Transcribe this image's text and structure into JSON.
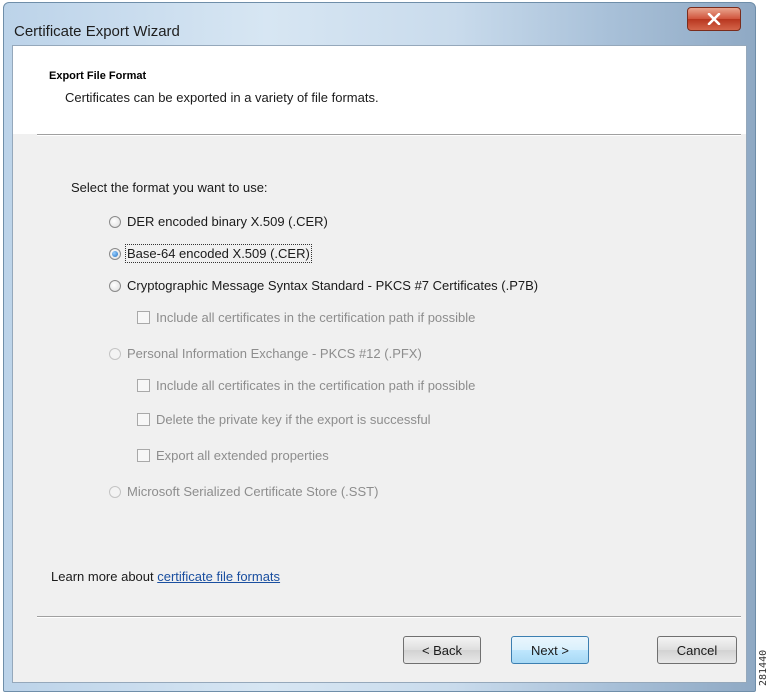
{
  "window": {
    "title": "Certificate Export Wizard",
    "close_icon": "close-x-icon"
  },
  "header": {
    "title": "Export File Format",
    "subtitle": "Certificates can be exported in a variety of file formats."
  },
  "prompt": "Select the format you want to use:",
  "options": [
    {
      "label": "DER encoded binary X.509 (.CER)",
      "selected": false,
      "enabled": true
    },
    {
      "label": "Base-64 encoded X.509 (.CER)",
      "selected": true,
      "enabled": true
    },
    {
      "label": "Cryptographic Message Syntax Standard - PKCS #7 Certificates (.P7B)",
      "selected": false,
      "enabled": true
    },
    {
      "label": "Personal Information Exchange - PKCS #12 (.PFX)",
      "selected": false,
      "enabled": false
    },
    {
      "label": "Microsoft Serialized Certificate Store (.SST)",
      "selected": false,
      "enabled": false
    }
  ],
  "checkboxes": {
    "p7b_include_path": {
      "label": "Include all certificates in the certification path if possible",
      "checked": false,
      "enabled": false
    },
    "pfx_include_path": {
      "label": "Include all certificates in the certification path if possible",
      "checked": false,
      "enabled": false
    },
    "pfx_delete_key": {
      "label": "Delete the private key if the export is successful",
      "checked": false,
      "enabled": false
    },
    "pfx_export_ext": {
      "label": "Export all extended properties",
      "checked": false,
      "enabled": false
    }
  },
  "learn_more": {
    "prefix": "Learn more about ",
    "link": "certificate file formats"
  },
  "buttons": {
    "back": "< Back",
    "next": "Next >",
    "cancel": "Cancel"
  },
  "figure_id": "281440"
}
